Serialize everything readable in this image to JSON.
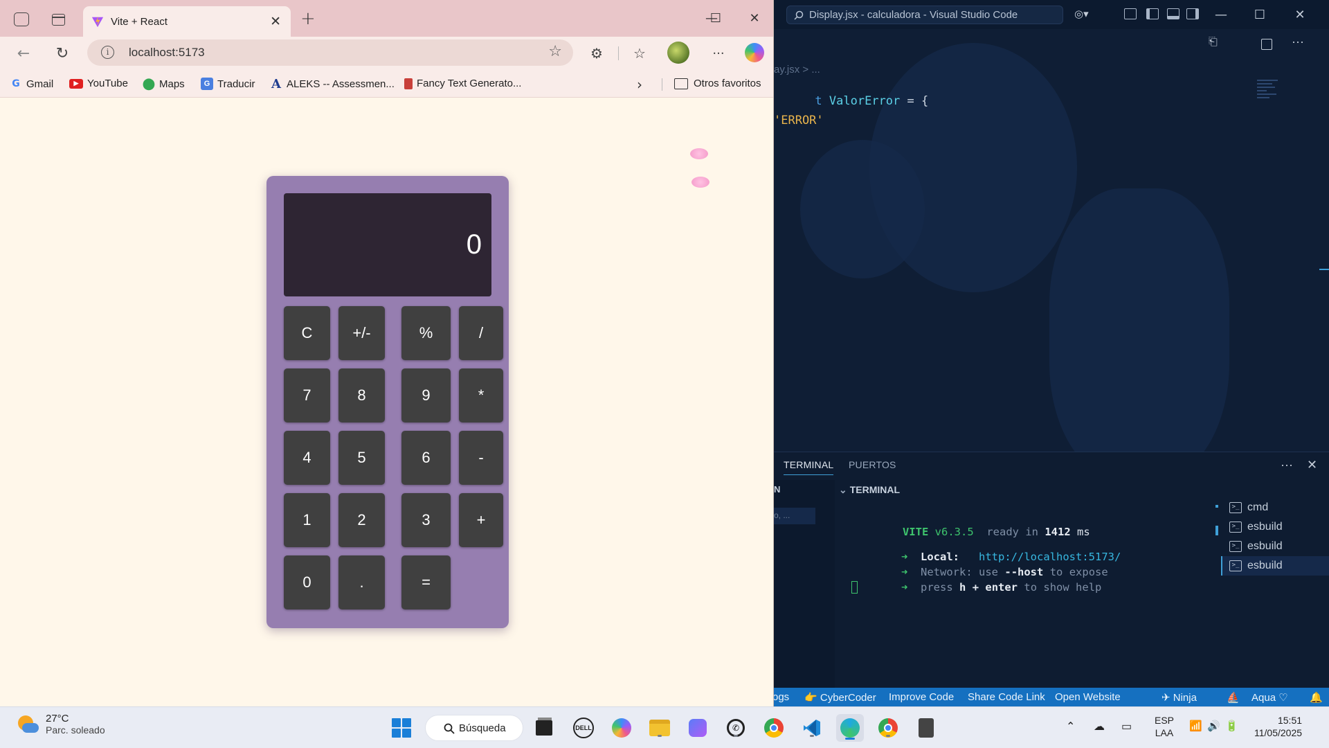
{
  "vscode": {
    "title": "Display.jsx - calculadora - Visual Studio Code",
    "breadcrumb": "ay.jsx > ...",
    "code": [
      {
        "kw": "t",
        "name": "ValorError",
        "rest": " = {"
      },
      {
        "str": "'ERROR'"
      }
    ],
    "panel_tabs": [
      "TERMINAL",
      "PUERTOS"
    ],
    "left_stub": "N",
    "left_item": "o, ...",
    "terminal_header": "TERMINAL",
    "terminal": {
      "vite_name": "VITE",
      "vite_version": "v6.3.5",
      "ready_text": "ready in",
      "ready_ms": "1412",
      "ms_unit": "ms",
      "arrow": "➜",
      "local_label": "Local:",
      "local_url": "http://localhost:5173/",
      "network_label": "Network:",
      "network_use": "use",
      "network_flag": "--host",
      "network_rest": "to expose",
      "press": "press",
      "h_key": "h + enter",
      "help_rest": "to show help"
    },
    "terminal_list": [
      "cmd",
      "esbuild",
      "esbuild",
      "esbuild"
    ],
    "status": [
      "ogs",
      "CyberCoder",
      "Improve Code",
      "Share Code Link",
      "Open Website",
      "Ninja",
      "Aqua"
    ]
  },
  "browser": {
    "tab_title": "Vite + React",
    "url": "localhost:5173",
    "bookmarks": [
      "Gmail",
      "YouTube",
      "Maps",
      "Traducir",
      "ALEKS -- Assessmen...",
      "Fancy Text Generato..."
    ],
    "other_bookmarks": "Otros favoritos"
  },
  "calculator": {
    "display": "0",
    "keys": [
      [
        "C",
        "+/-",
        "%",
        "/"
      ],
      [
        "7",
        "8",
        "9",
        "*"
      ],
      [
        "4",
        "5",
        "6",
        "-"
      ],
      [
        "1",
        "2",
        "3",
        "+"
      ],
      [
        "0",
        ".",
        "="
      ]
    ]
  },
  "taskbar": {
    "temperature": "27°C",
    "weather": "Parc. soleado",
    "search": "Búsqueda",
    "lang1": "ESP",
    "lang2": "LAA",
    "time": "15:51",
    "date": "11/05/2025"
  },
  "colors": {
    "calculator_body": "#967eb0",
    "calculator_display": "#2e2533",
    "key": "#404040",
    "page_bg": "#fff7ea",
    "vscode_status": "#1570c0"
  }
}
